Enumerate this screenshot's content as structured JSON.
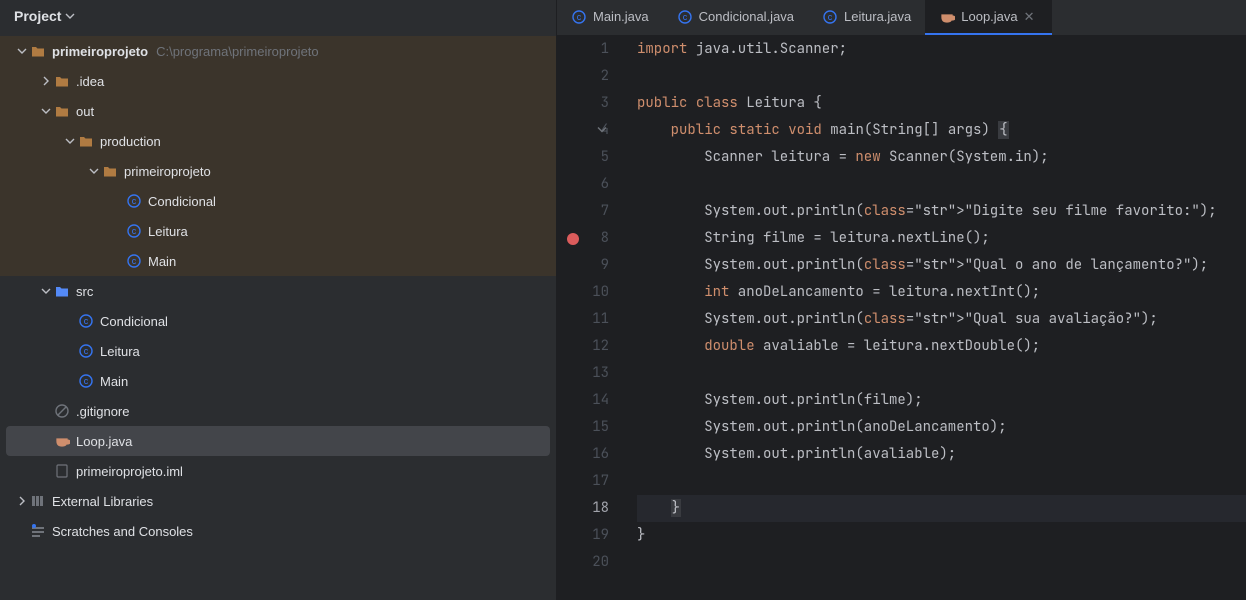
{
  "sidebar": {
    "title": "Project",
    "root": {
      "name": "primeiroprojeto",
      "path": "C:\\programa\\primeiroprojeto"
    },
    "items": {
      "idea": ".idea",
      "out": "out",
      "production": "production",
      "prjfolder": "primeiroprojeto",
      "condicional": "Condicional",
      "leitura": "Leitura",
      "main": "Main",
      "src": "src",
      "src_condicional": "Condicional",
      "src_leitura": "Leitura",
      "src_main": "Main",
      "gitignore": ".gitignore",
      "loop": "Loop.java",
      "iml": "primeiroprojeto.iml",
      "ext": "External Libraries",
      "scratch": "Scratches and Consoles"
    }
  },
  "tabs": [
    {
      "label": "Main.java",
      "icon": "class"
    },
    {
      "label": "Condicional.java",
      "icon": "class"
    },
    {
      "label": "Leitura.java",
      "icon": "class"
    },
    {
      "label": "Loop.java",
      "icon": "java",
      "active": true
    }
  ],
  "code": {
    "lines": [
      "import java.util.Scanner;",
      "",
      "public class Leitura {",
      "    public static void main(String[] args) {",
      "        Scanner leitura = new Scanner(System.in);",
      "",
      "        System.out.println(\"Digite seu filme favorito:\");",
      "        String filme = leitura.nextLine();",
      "        System.out.println(\"Qual o ano de lançamento?\");",
      "        int anoDeLancamento = leitura.nextInt();",
      "        System.out.println(\"Qual sua avaliação?\");",
      "        double avaliable = leitura.nextDouble();",
      "",
      "        System.out.println(filme);",
      "        System.out.println(anoDeLancamento);",
      "        System.out.println(avaliable);",
      "",
      "    }",
      "}",
      ""
    ],
    "line_numbers": [
      "1",
      "2",
      "3",
      "4",
      "5",
      "6",
      "7",
      "8",
      "9",
      "10",
      "11",
      "12",
      "13",
      "14",
      "15",
      "16",
      "17",
      "18",
      "19",
      "20"
    ],
    "breakpoint_line": 8,
    "current_line": 18
  }
}
